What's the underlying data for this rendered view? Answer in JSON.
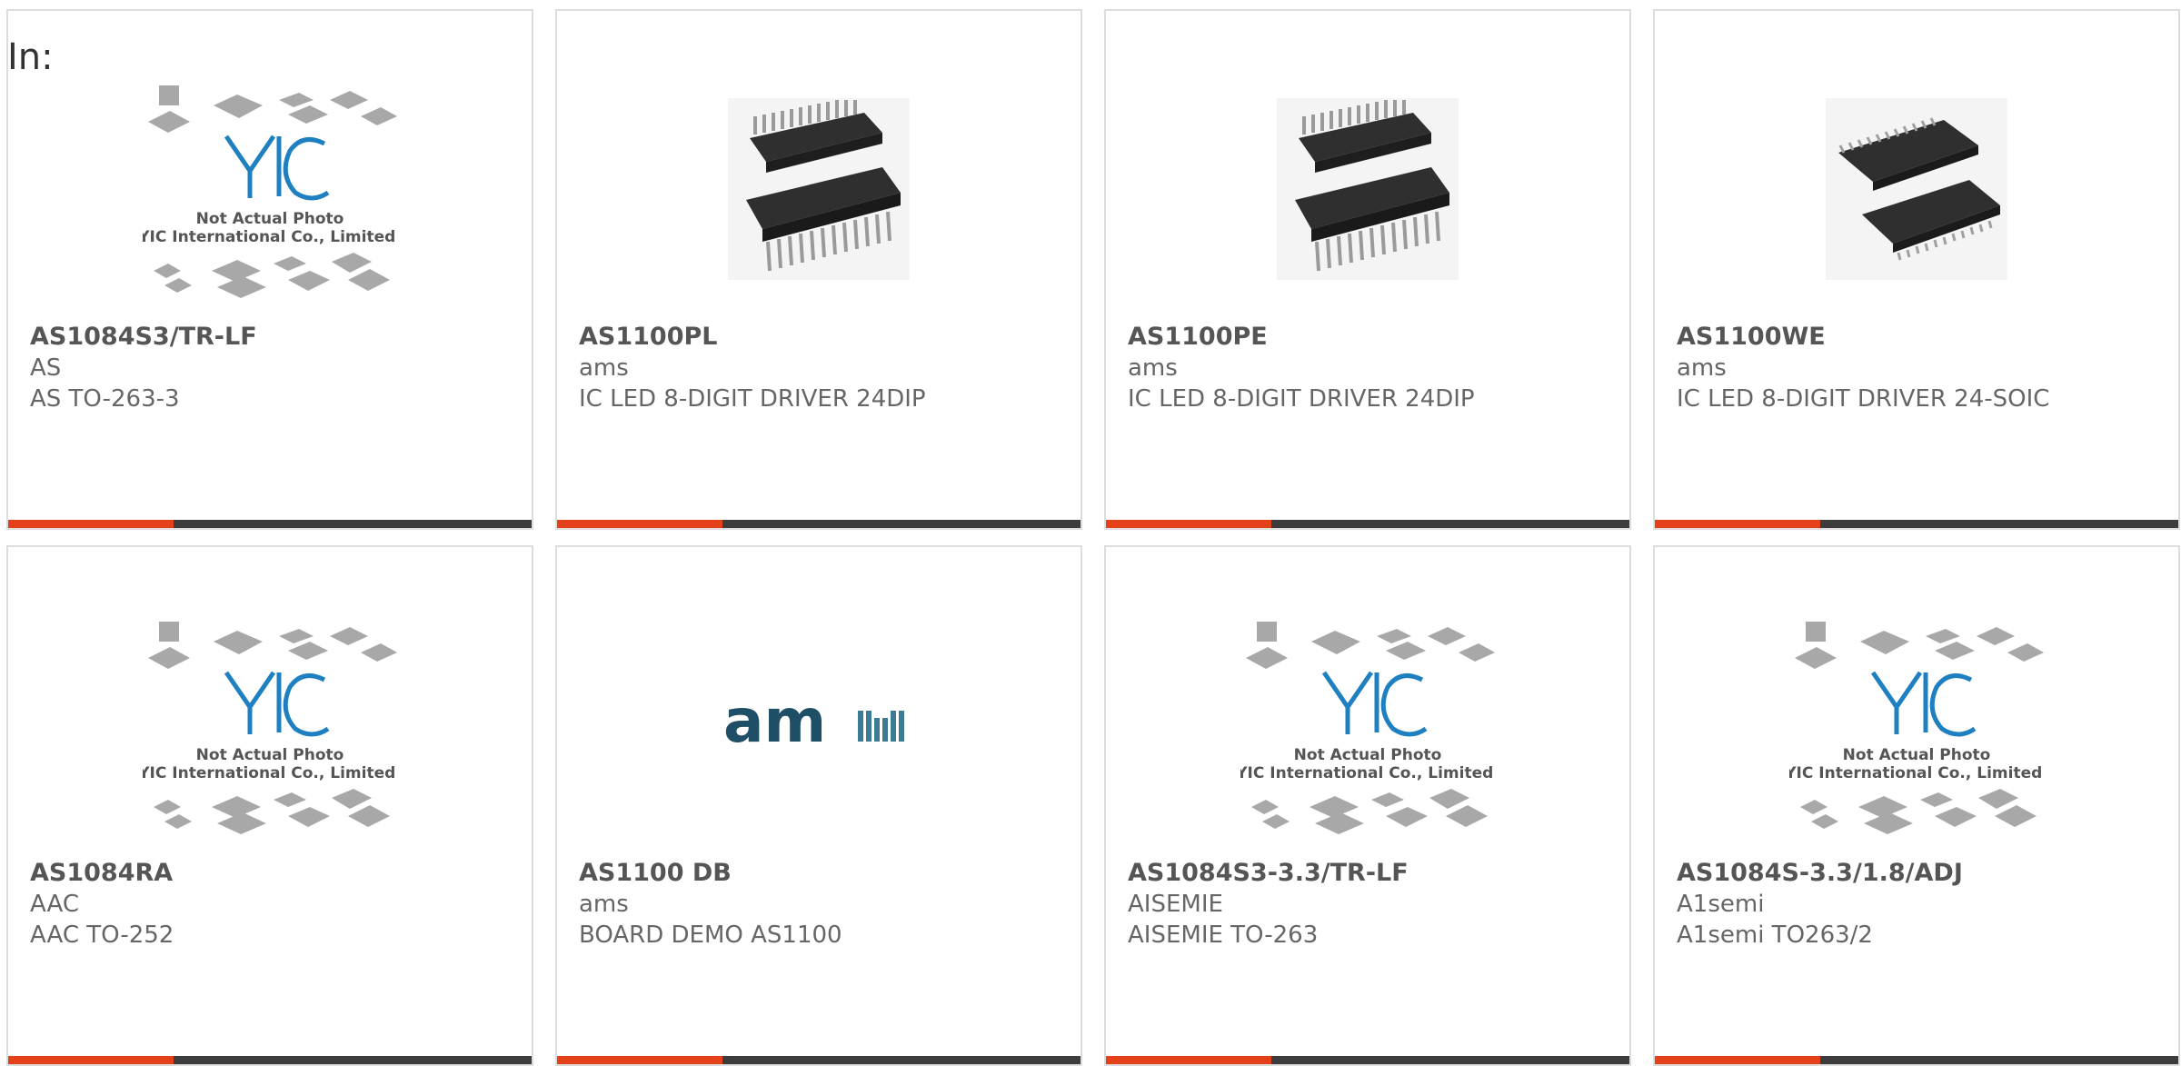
{
  "filter_label": "In:",
  "colors": {
    "accent": "#e4411b",
    "bar": "#3c3c3c",
    "border": "#dddddd"
  },
  "placeholder_logo": {
    "brand": "YIC",
    "caption_line1": "Not Actual Photo",
    "caption_line2": "YIC International Co., Limited."
  },
  "products": [
    {
      "part_number": "AS1084S3/TR-LF",
      "manufacturer": "AS",
      "description": "AS TO-263-3",
      "image": "yic-placeholder-icon"
    },
    {
      "part_number": "AS1100PL",
      "manufacturer": "ams",
      "description": "IC LED 8-DIGIT DRIVER 24DIP",
      "image": "dip-chip-icon"
    },
    {
      "part_number": "AS1100PE",
      "manufacturer": "ams",
      "description": "IC LED 8-DIGIT DRIVER 24DIP",
      "image": "dip-chip-icon"
    },
    {
      "part_number": "AS1100WE",
      "manufacturer": "ams",
      "description": "IC LED 8-DIGIT DRIVER 24-SOIC",
      "image": "soic-chip-icon"
    },
    {
      "part_number": "AS1084RA",
      "manufacturer": "AAC",
      "description": "AAC TO-252",
      "image": "yic-placeholder-icon"
    },
    {
      "part_number": "AS1100 DB",
      "manufacturer": "ams",
      "description": "BOARD DEMO AS1100",
      "image": "ams-logo-icon",
      "logo_text": "am"
    },
    {
      "part_number": "AS1084S3-3.3/TR-LF",
      "manufacturer": "AISEMIE",
      "description": "AISEMIE TO-263",
      "image": "yic-placeholder-icon"
    },
    {
      "part_number": "AS1084S-3.3/1.8/ADJ",
      "manufacturer": "A1semi",
      "description": "A1semi TO263/2",
      "image": "yic-placeholder-icon"
    }
  ]
}
